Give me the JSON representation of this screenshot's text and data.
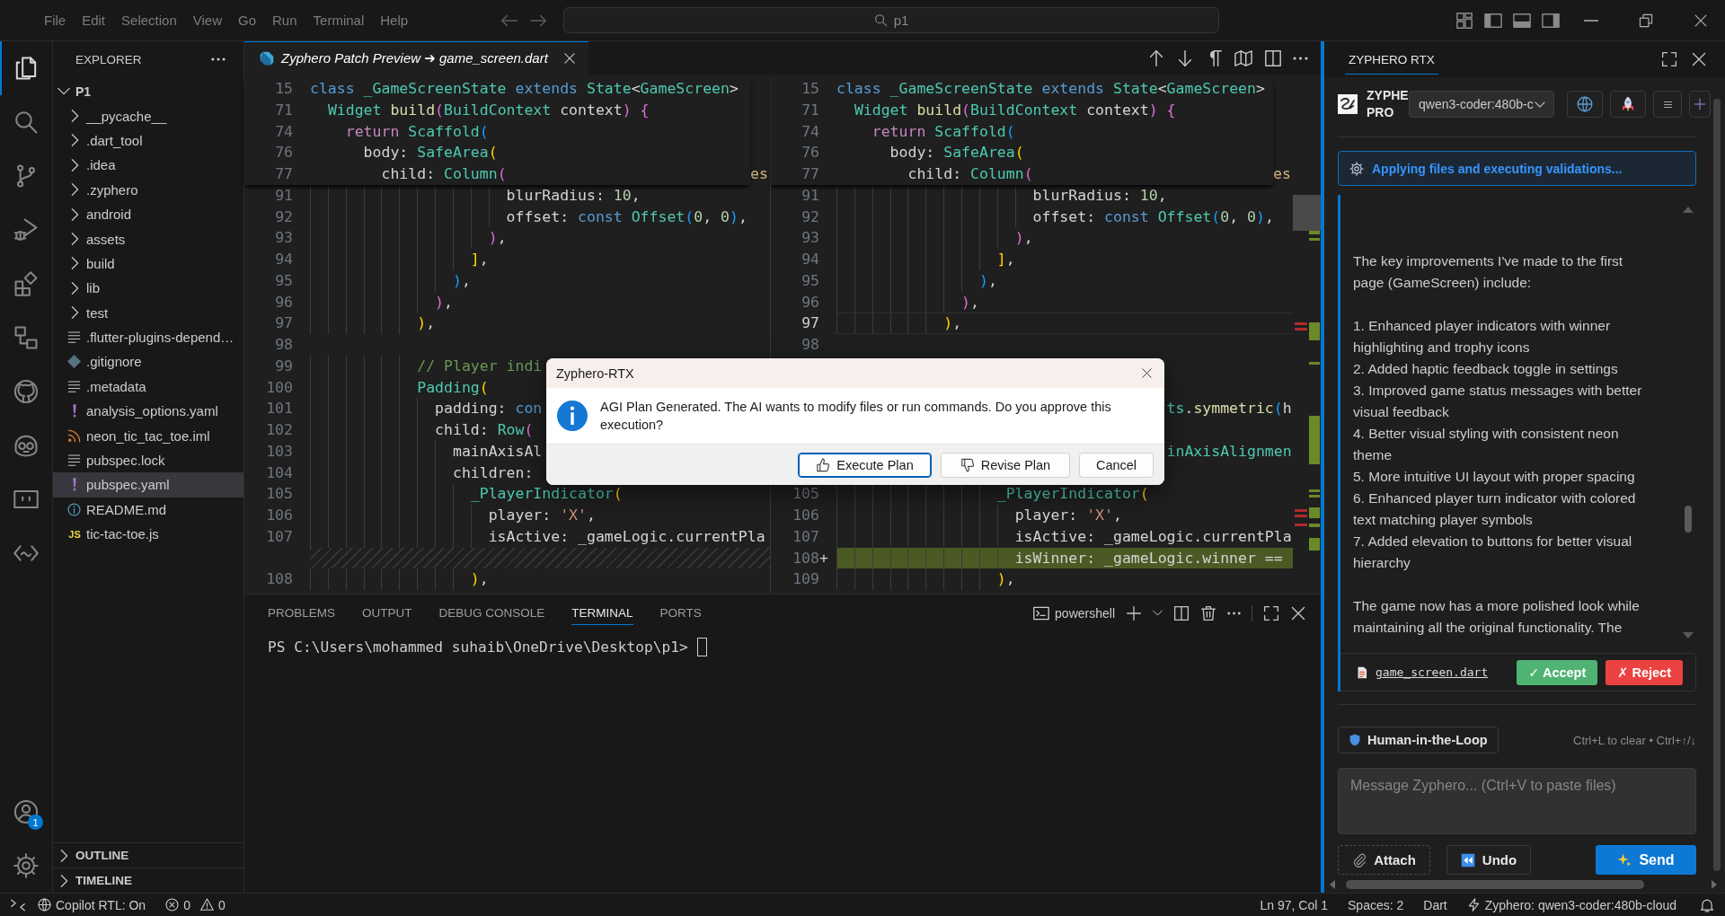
{
  "title_bar": {
    "menu": [
      "File",
      "Edit",
      "Selection",
      "View",
      "Go",
      "Run",
      "Terminal",
      "Help"
    ],
    "search": {
      "value": "p1"
    }
  },
  "activity_bar": {
    "items": [
      {
        "kind": "explorer",
        "selected": true
      },
      {
        "kind": "search",
        "selected": false
      },
      {
        "kind": "source-control",
        "selected": false
      },
      {
        "kind": "run-debug",
        "selected": false
      },
      {
        "kind": "extensions",
        "selected": false
      },
      {
        "kind": "remote-explorer",
        "selected": false
      },
      {
        "kind": "github",
        "selected": false
      },
      {
        "kind": "robot",
        "selected": false
      },
      {
        "kind": "face-box",
        "selected": false
      },
      {
        "kind": "code-wave",
        "selected": false
      }
    ],
    "account_badge": "1"
  },
  "explorer": {
    "title": "EXPLORER",
    "root": {
      "label": "P1",
      "expanded": true,
      "selected": false,
      "children": [
        {
          "label": "__pycache__",
          "kind": "folder",
          "expanded": false,
          "selected": false
        },
        {
          "label": ".dart_tool",
          "kind": "folder",
          "expanded": false,
          "selected": false
        },
        {
          "label": ".idea",
          "kind": "folder",
          "expanded": false,
          "selected": false
        },
        {
          "label": ".zyphero",
          "kind": "folder",
          "expanded": false,
          "selected": false
        },
        {
          "label": "android",
          "kind": "folder",
          "expanded": false,
          "selected": false
        },
        {
          "label": "assets",
          "kind": "folder",
          "expanded": false,
          "selected": false
        },
        {
          "label": "build",
          "kind": "folder",
          "expanded": false,
          "selected": false
        },
        {
          "label": "lib",
          "kind": "folder",
          "expanded": false,
          "selected": false
        },
        {
          "label": "test",
          "kind": "folder",
          "expanded": false,
          "selected": false
        },
        {
          "label": ".flutter-plugins-depend…",
          "kind": "lines",
          "selected": false
        },
        {
          "label": ".gitignore",
          "kind": "git",
          "selected": false
        },
        {
          "label": ".metadata",
          "kind": "lines",
          "selected": false
        },
        {
          "label": "analysis_options.yaml",
          "kind": "yaml",
          "selected": false
        },
        {
          "label": "neon_tic_tac_toe.iml",
          "kind": "rss",
          "selected": false
        },
        {
          "label": "pubspec.lock",
          "kind": "lines",
          "selected": false
        },
        {
          "label": "pubspec.yaml",
          "kind": "yaml",
          "selected": true
        },
        {
          "label": "README.md",
          "kind": "info",
          "selected": false
        },
        {
          "label": "tic-tac-toe.js",
          "kind": "js",
          "icon_text": "JS",
          "selected": false
        }
      ]
    },
    "sections": [
      {
        "label": "OUTLINE",
        "expanded": false
      },
      {
        "label": "TIMELINE",
        "expanded": false
      }
    ]
  },
  "editor": {
    "tabs": [
      {
        "title": "Zyphero Patch Preview ➔ game_screen.dart",
        "selected": true,
        "preview": true
      }
    ],
    "panes": [
      {
        "kind": "original",
        "sticky": [
          {
            "number": "15",
            "kind": "normal",
            "tokens": [
              {
                "kind": "keyword",
                "text": "class "
              },
              {
                "kind": "type",
                "text": "_GameScreenState "
              },
              {
                "kind": "keyword",
                "text": "extends "
              },
              {
                "kind": "type",
                "text": "State"
              },
              {
                "kind": "plain",
                "text": "<"
              },
              {
                "kind": "type",
                "text": "GameScreen"
              },
              {
                "kind": "plain",
                "text": ">"
              }
            ]
          },
          {
            "number": "71",
            "kind": "normal",
            "tokens": [
              {
                "kind": "type",
                "text": "  Widget "
              },
              {
                "kind": "function",
                "text": "build"
              },
              {
                "kind": "bracket2",
                "text": "("
              },
              {
                "kind": "type",
                "text": "BuildContext "
              },
              {
                "kind": "plain",
                "text": "context"
              },
              {
                "kind": "bracket2",
                "text": ") {"
              }
            ]
          },
          {
            "number": "74",
            "kind": "normal",
            "tokens": [
              {
                "kind": "control",
                "text": "    return "
              },
              {
                "kind": "type",
                "text": "Scaffold"
              },
              {
                "kind": "bracket3",
                "text": "("
              }
            ]
          },
          {
            "number": "76",
            "kind": "normal",
            "tokens": [
              {
                "kind": "plain",
                "text": "      body: "
              },
              {
                "kind": "type",
                "text": "SafeArea"
              },
              {
                "kind": "bracket1",
                "text": "("
              }
            ]
          },
          {
            "number": "77",
            "kind": "normal",
            "tokens": [
              {
                "kind": "plain",
                "text": "        child: "
              },
              {
                "kind": "type",
                "text": "Column"
              },
              {
                "kind": "bracket2",
                "text": "("
              }
            ]
          }
        ],
        "tail": "es",
        "lines": [
          {
            "number": "91",
            "kind": "normal",
            "tokens": [
              {
                "kind": "plain",
                "text": "                      blurRadius: "
              },
              {
                "kind": "number",
                "text": "10"
              },
              {
                "kind": "plain",
                "text": ","
              }
            ]
          },
          {
            "number": "92",
            "kind": "normal",
            "tokens": [
              {
                "kind": "plain",
                "text": "                      offset: "
              },
              {
                "kind": "keyword",
                "text": "const "
              },
              {
                "kind": "type",
                "text": "Offset"
              },
              {
                "kind": "bracket3",
                "text": "("
              },
              {
                "kind": "number",
                "text": "0"
              },
              {
                "kind": "plain",
                "text": ", "
              },
              {
                "kind": "number",
                "text": "0"
              },
              {
                "kind": "bracket3",
                "text": ")"
              },
              {
                "kind": "plain",
                "text": ","
              }
            ]
          },
          {
            "number": "93",
            "kind": "normal",
            "tokens": [
              {
                "kind": "bracket2",
                "text": "                    )"
              },
              {
                "kind": "plain",
                "text": ","
              }
            ]
          },
          {
            "number": "94",
            "kind": "normal",
            "tokens": [
              {
                "kind": "bracket1",
                "text": "                  ]"
              },
              {
                "kind": "plain",
                "text": ","
              }
            ]
          },
          {
            "number": "95",
            "kind": "normal",
            "tokens": [
              {
                "kind": "bracket3",
                "text": "                )"
              },
              {
                "kind": "plain",
                "text": ","
              }
            ]
          },
          {
            "number": "96",
            "kind": "normal",
            "tokens": [
              {
                "kind": "bracket2",
                "text": "              )"
              },
              {
                "kind": "plain",
                "text": ","
              }
            ]
          },
          {
            "number": "97",
            "kind": "normal",
            "tokens": [
              {
                "kind": "bracket1",
                "text": "            )"
              },
              {
                "kind": "plain",
                "text": ","
              }
            ]
          },
          {
            "number": "98",
            "kind": "normal"
          },
          {
            "number": "99",
            "kind": "normal",
            "tokens": [
              {
                "kind": "comment",
                "text": "            // Player indi"
              }
            ]
          },
          {
            "number": "100",
            "kind": "normal",
            "tokens": [
              {
                "kind": "type",
                "text": "            Padding"
              },
              {
                "kind": "bracket1",
                "text": "("
              }
            ]
          },
          {
            "number": "101",
            "kind": "normal",
            "tokens": [
              {
                "kind": "plain",
                "text": "              padding: "
              },
              {
                "kind": "keyword",
                "text": "con"
              }
            ]
          },
          {
            "number": "102",
            "kind": "normal",
            "tokens": [
              {
                "kind": "plain",
                "text": "              child: "
              },
              {
                "kind": "type",
                "text": "Row"
              },
              {
                "kind": "bracket2",
                "text": "("
              }
            ]
          },
          {
            "number": "103",
            "kind": "normal",
            "tokens": [
              {
                "kind": "plain",
                "text": "                mainAxisAl"
              }
            ]
          },
          {
            "number": "104",
            "kind": "normal",
            "tokens": [
              {
                "kind": "plain",
                "text": "                children:"
              }
            ]
          },
          {
            "number": "105",
            "kind": "normal",
            "tokens": [
              {
                "kind": "type",
                "text": "                  _PlayerIndicator"
              },
              {
                "kind": "bracket1",
                "text": "("
              }
            ]
          },
          {
            "number": "106",
            "kind": "normal",
            "tokens": [
              {
                "kind": "plain",
                "text": "                    player: "
              },
              {
                "kind": "string",
                "text": "'X'"
              },
              {
                "kind": "plain",
                "text": ","
              }
            ]
          },
          {
            "number": "107",
            "kind": "normal",
            "tokens": [
              {
                "kind": "plain",
                "text": "                    isActive: _gameLogic.currentPla"
              }
            ]
          },
          {
            "kind": "filler"
          },
          {
            "number": "108",
            "kind": "normal",
            "tokens": [
              {
                "kind": "bracket1",
                "text": "                  )"
              },
              {
                "kind": "plain",
                "text": ","
              }
            ]
          }
        ]
      },
      {
        "kind": "modified",
        "sticky": [
          {
            "number": "15",
            "kind": "normal",
            "tokens": [
              {
                "kind": "keyword",
                "text": "class "
              },
              {
                "kind": "type",
                "text": "_GameScreenState "
              },
              {
                "kind": "keyword",
                "text": "extends "
              },
              {
                "kind": "type",
                "text": "State"
              },
              {
                "kind": "plain",
                "text": "<"
              },
              {
                "kind": "type",
                "text": "GameScreen"
              },
              {
                "kind": "plain",
                "text": ">"
              }
            ]
          },
          {
            "number": "71",
            "kind": "normal",
            "tokens": [
              {
                "kind": "type",
                "text": "  Widget "
              },
              {
                "kind": "function",
                "text": "build"
              },
              {
                "kind": "bracket2",
                "text": "("
              },
              {
                "kind": "type",
                "text": "BuildContext "
              },
              {
                "kind": "plain",
                "text": "context"
              },
              {
                "kind": "bracket2",
                "text": ") {"
              }
            ]
          },
          {
            "number": "74",
            "kind": "normal",
            "tokens": [
              {
                "kind": "control",
                "text": "    return "
              },
              {
                "kind": "type",
                "text": "Scaffold"
              },
              {
                "kind": "bracket3",
                "text": "("
              }
            ]
          },
          {
            "number": "76",
            "kind": "normal",
            "tokens": [
              {
                "kind": "plain",
                "text": "      body: "
              },
              {
                "kind": "type",
                "text": "SafeArea"
              },
              {
                "kind": "bracket1",
                "text": "("
              }
            ]
          },
          {
            "number": "77",
            "kind": "normal",
            "tokens": [
              {
                "kind": "plain",
                "text": "        child: "
              },
              {
                "kind": "type",
                "text": "Column"
              },
              {
                "kind": "bracket2",
                "text": "("
              }
            ]
          }
        ],
        "tail": "es",
        "lines": [
          {
            "number": "91",
            "kind": "normal",
            "tokens": [
              {
                "kind": "plain",
                "text": "                      blurRadius: "
              },
              {
                "kind": "number",
                "text": "10"
              },
              {
                "kind": "plain",
                "text": ","
              }
            ]
          },
          {
            "number": "92",
            "kind": "normal",
            "tokens": [
              {
                "kind": "plain",
                "text": "                      offset: "
              },
              {
                "kind": "keyword",
                "text": "const "
              },
              {
                "kind": "type",
                "text": "Offset"
              },
              {
                "kind": "bracket3",
                "text": "("
              },
              {
                "kind": "number",
                "text": "0"
              },
              {
                "kind": "plain",
                "text": ", "
              },
              {
                "kind": "number",
                "text": "0"
              },
              {
                "kind": "bracket3",
                "text": ")"
              },
              {
                "kind": "plain",
                "text": ","
              }
            ]
          },
          {
            "number": "93",
            "kind": "normal",
            "tokens": [
              {
                "kind": "bracket2",
                "text": "                    )"
              },
              {
                "kind": "plain",
                "text": ","
              }
            ]
          },
          {
            "number": "94",
            "kind": "normal",
            "tokens": [
              {
                "kind": "bracket1",
                "text": "                  ]"
              },
              {
                "kind": "plain",
                "text": ","
              }
            ]
          },
          {
            "number": "95",
            "kind": "normal",
            "tokens": [
              {
                "kind": "bracket3",
                "text": "                )"
              },
              {
                "kind": "plain",
                "text": ","
              }
            ]
          },
          {
            "number": "96",
            "kind": "normal",
            "tokens": [
              {
                "kind": "bracket2",
                "text": "              )"
              },
              {
                "kind": "plain",
                "text": ","
              }
            ]
          },
          {
            "number": "97",
            "kind": "current",
            "tokens": [
              {
                "kind": "bracket1",
                "text": "            )"
              },
              {
                "kind": "plain",
                "text": ","
              }
            ]
          },
          {
            "number": "98",
            "kind": "normal"
          },
          {
            "kind": "normal"
          },
          {
            "kind": "normal"
          },
          {
            "kind": "normal",
            "tokens": [
              {
                "kind": "type",
                "text": "                                     ts"
              },
              {
                "kind": "plain",
                "text": "."
              },
              {
                "kind": "function",
                "text": "symmetric"
              },
              {
                "kind": "bracket3",
                "text": "("
              },
              {
                "kind": "plain",
                "text": "h"
              }
            ]
          },
          {
            "kind": "normal"
          },
          {
            "kind": "normal",
            "tokens": [
              {
                "kind": "type",
                "text": "                                     inAxisAlignmen"
              }
            ]
          },
          {
            "kind": "normal"
          },
          {
            "number": "105",
            "kind": "normal",
            "tokens": [
              {
                "kind": "type",
                "text": "                  _PlayerIndicator"
              },
              {
                "kind": "bracket1",
                "text": "("
              }
            ]
          },
          {
            "number": "106",
            "kind": "normal",
            "tokens": [
              {
                "kind": "plain",
                "text": "                    player: "
              },
              {
                "kind": "string",
                "text": "'X'"
              },
              {
                "kind": "plain",
                "text": ","
              }
            ]
          },
          {
            "number": "107",
            "kind": "normal",
            "tokens": [
              {
                "kind": "plain",
                "text": "                    isActive: _gameLogic.currentPla"
              }
            ]
          },
          {
            "number": "108",
            "marker": "+",
            "kind": "added",
            "tokens": [
              {
                "kind": "plain",
                "text": "                    isWinner: _gameLogic.winner =="
              }
            ]
          },
          {
            "number": "109",
            "kind": "normal",
            "tokens": [
              {
                "kind": "bracket1",
                "text": "                  )"
              },
              {
                "kind": "plain",
                "text": ","
              }
            ]
          }
        ]
      }
    ]
  },
  "dialog": {
    "title": "Zyphero-RTX",
    "message": "AGI Plan Generated. The AI wants to modify files or run commands. Do you approve this execution?",
    "buttons": [
      {
        "kind": "approve",
        "label": "Execute Plan",
        "default": true
      },
      {
        "kind": "revise",
        "label": "Revise Plan",
        "default": false
      },
      {
        "kind": "cancel",
        "label": "Cancel",
        "default": false
      }
    ]
  },
  "panel": {
    "tabs": [
      {
        "label": "PROBLEMS",
        "selected": false
      },
      {
        "label": "OUTPUT",
        "selected": false
      },
      {
        "label": "DEBUG CONSOLE",
        "selected": false
      },
      {
        "label": "TERMINAL",
        "selected": true
      },
      {
        "label": "PORTS",
        "selected": false
      }
    ],
    "terminal_name": "powershell",
    "prompt": "PS C:\\Users\\mohammed suhaib\\OneDrive\\Desktop\\p1>"
  },
  "assistant": {
    "title": "ZYPHERO RTX",
    "brand": [
      "ZYPHE",
      "PRO"
    ],
    "model_select": {
      "value": "qwen3-coder:480b-c"
    },
    "status": "Applying files and executing validations...",
    "message": {
      "intro": "The key improvements I've made to the first page (GameScreen) include:",
      "points": [
        "1. Enhanced player indicators with winner highlighting and trophy icons",
        "2. Added haptic feedback toggle in settings",
        "3. Improved game status messages with better visual feedback",
        "4. Better visual styling with consistent neon theme",
        "5. More intuitive UI layout with proper spacing",
        "6. Enhanced player turn indicator with colored text matching player symbols",
        "7. Added elevation to buttons for better visual hierarchy"
      ],
      "closing": "The game now has a more polished look while maintaining all the original functionality. The"
    },
    "file_change": {
      "file": "game_screen.dart",
      "accept": "✓ Accept",
      "reject": "✗ Reject"
    },
    "mode": "Human-in-the-Loop",
    "shortcut_hint": "Ctrl+L to clear • Ctrl+↑/↓",
    "input": {
      "placeholder": "Message Zyphero... (Ctrl+V to paste files)"
    },
    "buttons": [
      {
        "kind": "attach",
        "label": "Attach"
      },
      {
        "kind": "undo",
        "label": "Undo"
      },
      {
        "kind": "send",
        "label": "Send"
      }
    ]
  },
  "status_bar": {
    "copilot": "Copilot RTL: On",
    "errors": "0",
    "warnings": "0",
    "cursor_position": "Ln 97, Col 1",
    "indentation": "Spaces: 2",
    "language": "Dart",
    "model": "Zyphero: qwen3-coder:480b-cloud"
  }
}
